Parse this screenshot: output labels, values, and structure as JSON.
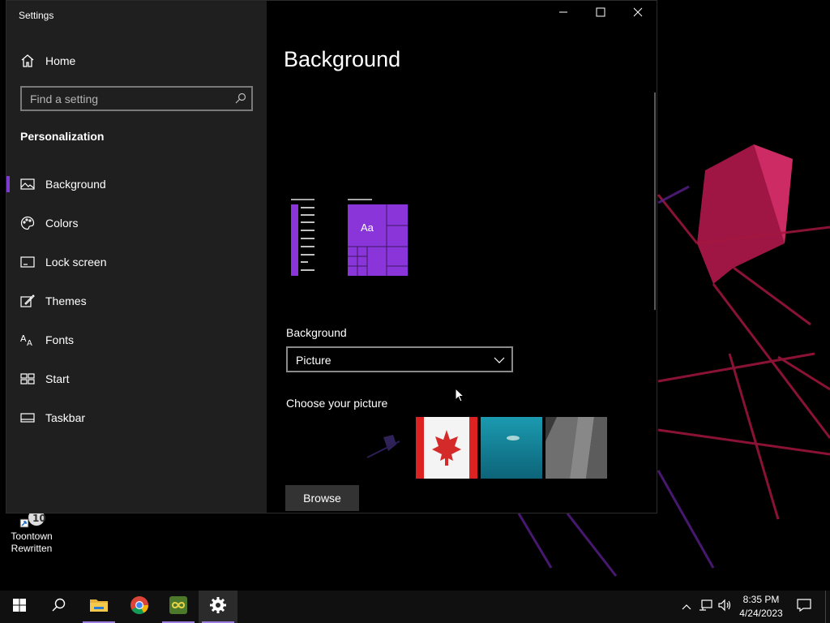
{
  "window": {
    "app_title": "Settings",
    "controls": {
      "minimize": "minimize",
      "maximize": "maximize",
      "close": "close"
    }
  },
  "sidebar": {
    "home_label": "Home",
    "search_placeholder": "Find a setting",
    "section_title": "Personalization",
    "items": [
      {
        "label": "Background",
        "icon": "picture-icon",
        "active": true
      },
      {
        "label": "Colors",
        "icon": "palette-icon",
        "active": false
      },
      {
        "label": "Lock screen",
        "icon": "lock-screen-icon",
        "active": false
      },
      {
        "label": "Themes",
        "icon": "themes-icon",
        "active": false
      },
      {
        "label": "Fonts",
        "icon": "fonts-icon",
        "active": false
      },
      {
        "label": "Start",
        "icon": "start-icon",
        "active": false
      },
      {
        "label": "Taskbar",
        "icon": "taskbar-icon",
        "active": false
      }
    ]
  },
  "main": {
    "title": "Background",
    "preview_tile_text": "Aa",
    "background_label": "Background",
    "background_value": "Picture",
    "choose_label": "Choose your picture",
    "browse_label": "Browse",
    "thumbnails": [
      "dark-abstract",
      "canada-flag",
      "underwater-swimmer",
      "rock-cliff"
    ]
  },
  "desktop": {
    "icon_label_line1": "Toontown",
    "icon_label_line2": "Rewritten"
  },
  "taskbar": {
    "apps": [
      "start-icon",
      "search-icon",
      "file-explorer-icon",
      "chrome-icon",
      "app-infinity-icon",
      "settings-icon"
    ],
    "time": "8:35 PM",
    "date": "4/24/2023"
  },
  "colors": {
    "accent": "#7d3ccf",
    "tile_purple": "#8a35d9",
    "sidebar_bg": "#1f1f1f"
  }
}
